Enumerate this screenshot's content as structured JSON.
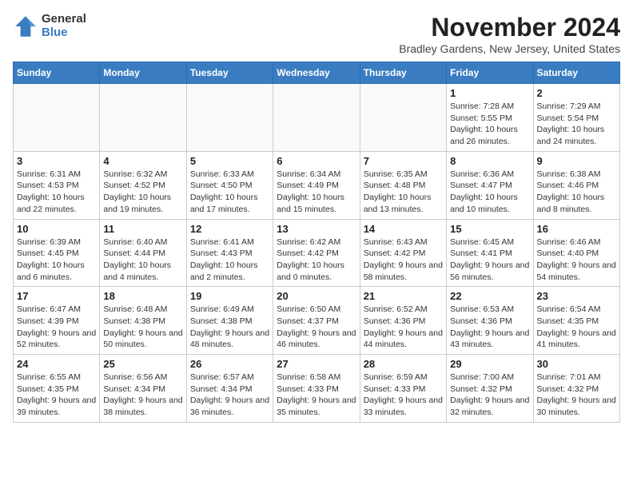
{
  "header": {
    "logo_general": "General",
    "logo_blue": "Blue",
    "month_title": "November 2024",
    "location": "Bradley Gardens, New Jersey, United States"
  },
  "days_of_week": [
    "Sunday",
    "Monday",
    "Tuesday",
    "Wednesday",
    "Thursday",
    "Friday",
    "Saturday"
  ],
  "weeks": [
    [
      {
        "day": "",
        "info": ""
      },
      {
        "day": "",
        "info": ""
      },
      {
        "day": "",
        "info": ""
      },
      {
        "day": "",
        "info": ""
      },
      {
        "day": "",
        "info": ""
      },
      {
        "day": "1",
        "info": "Sunrise: 7:28 AM\nSunset: 5:55 PM\nDaylight: 10 hours and 26 minutes."
      },
      {
        "day": "2",
        "info": "Sunrise: 7:29 AM\nSunset: 5:54 PM\nDaylight: 10 hours and 24 minutes."
      }
    ],
    [
      {
        "day": "3",
        "info": "Sunrise: 6:31 AM\nSunset: 4:53 PM\nDaylight: 10 hours and 22 minutes."
      },
      {
        "day": "4",
        "info": "Sunrise: 6:32 AM\nSunset: 4:52 PM\nDaylight: 10 hours and 19 minutes."
      },
      {
        "day": "5",
        "info": "Sunrise: 6:33 AM\nSunset: 4:50 PM\nDaylight: 10 hours and 17 minutes."
      },
      {
        "day": "6",
        "info": "Sunrise: 6:34 AM\nSunset: 4:49 PM\nDaylight: 10 hours and 15 minutes."
      },
      {
        "day": "7",
        "info": "Sunrise: 6:35 AM\nSunset: 4:48 PM\nDaylight: 10 hours and 13 minutes."
      },
      {
        "day": "8",
        "info": "Sunrise: 6:36 AM\nSunset: 4:47 PM\nDaylight: 10 hours and 10 minutes."
      },
      {
        "day": "9",
        "info": "Sunrise: 6:38 AM\nSunset: 4:46 PM\nDaylight: 10 hours and 8 minutes."
      }
    ],
    [
      {
        "day": "10",
        "info": "Sunrise: 6:39 AM\nSunset: 4:45 PM\nDaylight: 10 hours and 6 minutes."
      },
      {
        "day": "11",
        "info": "Sunrise: 6:40 AM\nSunset: 4:44 PM\nDaylight: 10 hours and 4 minutes."
      },
      {
        "day": "12",
        "info": "Sunrise: 6:41 AM\nSunset: 4:43 PM\nDaylight: 10 hours and 2 minutes."
      },
      {
        "day": "13",
        "info": "Sunrise: 6:42 AM\nSunset: 4:42 PM\nDaylight: 10 hours and 0 minutes."
      },
      {
        "day": "14",
        "info": "Sunrise: 6:43 AM\nSunset: 4:42 PM\nDaylight: 9 hours and 58 minutes."
      },
      {
        "day": "15",
        "info": "Sunrise: 6:45 AM\nSunset: 4:41 PM\nDaylight: 9 hours and 56 minutes."
      },
      {
        "day": "16",
        "info": "Sunrise: 6:46 AM\nSunset: 4:40 PM\nDaylight: 9 hours and 54 minutes."
      }
    ],
    [
      {
        "day": "17",
        "info": "Sunrise: 6:47 AM\nSunset: 4:39 PM\nDaylight: 9 hours and 52 minutes."
      },
      {
        "day": "18",
        "info": "Sunrise: 6:48 AM\nSunset: 4:38 PM\nDaylight: 9 hours and 50 minutes."
      },
      {
        "day": "19",
        "info": "Sunrise: 6:49 AM\nSunset: 4:38 PM\nDaylight: 9 hours and 48 minutes."
      },
      {
        "day": "20",
        "info": "Sunrise: 6:50 AM\nSunset: 4:37 PM\nDaylight: 9 hours and 46 minutes."
      },
      {
        "day": "21",
        "info": "Sunrise: 6:52 AM\nSunset: 4:36 PM\nDaylight: 9 hours and 44 minutes."
      },
      {
        "day": "22",
        "info": "Sunrise: 6:53 AM\nSunset: 4:36 PM\nDaylight: 9 hours and 43 minutes."
      },
      {
        "day": "23",
        "info": "Sunrise: 6:54 AM\nSunset: 4:35 PM\nDaylight: 9 hours and 41 minutes."
      }
    ],
    [
      {
        "day": "24",
        "info": "Sunrise: 6:55 AM\nSunset: 4:35 PM\nDaylight: 9 hours and 39 minutes."
      },
      {
        "day": "25",
        "info": "Sunrise: 6:56 AM\nSunset: 4:34 PM\nDaylight: 9 hours and 38 minutes."
      },
      {
        "day": "26",
        "info": "Sunrise: 6:57 AM\nSunset: 4:34 PM\nDaylight: 9 hours and 36 minutes."
      },
      {
        "day": "27",
        "info": "Sunrise: 6:58 AM\nSunset: 4:33 PM\nDaylight: 9 hours and 35 minutes."
      },
      {
        "day": "28",
        "info": "Sunrise: 6:59 AM\nSunset: 4:33 PM\nDaylight: 9 hours and 33 minutes."
      },
      {
        "day": "29",
        "info": "Sunrise: 7:00 AM\nSunset: 4:32 PM\nDaylight: 9 hours and 32 minutes."
      },
      {
        "day": "30",
        "info": "Sunrise: 7:01 AM\nSunset: 4:32 PM\nDaylight: 9 hours and 30 minutes."
      }
    ]
  ]
}
